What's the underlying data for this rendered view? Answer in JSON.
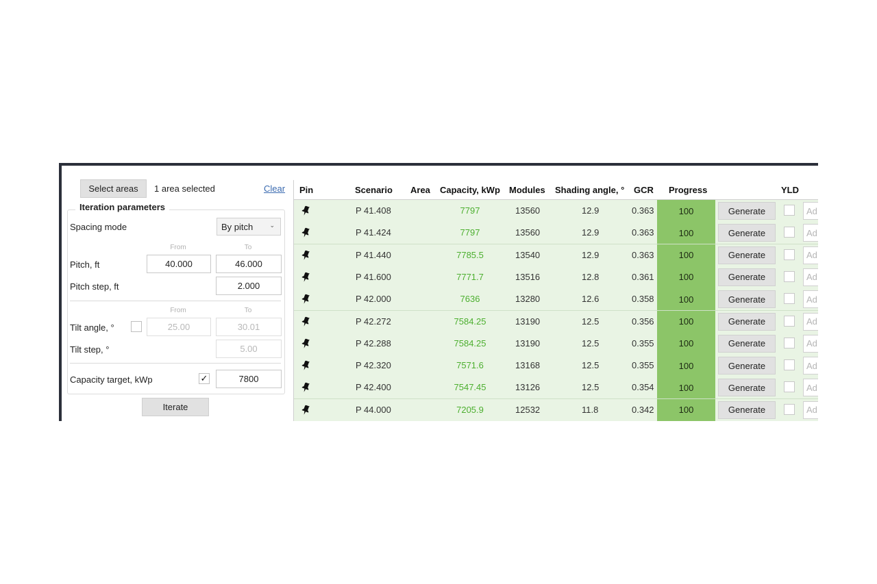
{
  "left_panel": {
    "select_areas_label": "Select areas",
    "area_status": "1 area selected",
    "clear_label": "Clear",
    "group_title": "Iteration parameters",
    "spacing_mode_label": "Spacing mode",
    "spacing_mode_value": "By pitch",
    "from_label": "From",
    "to_label": "To",
    "pitch_label": "Pitch, ft",
    "pitch_from": "40.000",
    "pitch_to": "46.000",
    "pitch_step_label": "Pitch step, ft",
    "pitch_step": "2.000",
    "tilt_angle_label": "Tilt angle, °",
    "tilt_from": "25.00",
    "tilt_to": "30.01",
    "tilt_step_label": "Tilt step, °",
    "tilt_step": "5.00",
    "capacity_target_label": "Capacity target, kWp",
    "capacity_target_checked": true,
    "capacity_target_check_glyph": "✓",
    "capacity_target": "7800",
    "iterate_label": "Iterate"
  },
  "grid": {
    "headers": {
      "pin": "Pin",
      "scenario": "Scenario",
      "area": "Area",
      "capacity": "Capacity, kWp",
      "modules": "Modules",
      "shading": "Shading angle, °",
      "gcr": "GCR",
      "progress": "Progress",
      "yld": "YLD"
    },
    "generate_label": "Generate",
    "yld_placeholder": "Ad",
    "rows": [
      {
        "scenario": "P 41.408",
        "capacity": "7797",
        "modules": "13560",
        "shading": "12.9",
        "gcr": "0.363",
        "progress": "100"
      },
      {
        "scenario": "P 41.424",
        "capacity": "7797",
        "modules": "13560",
        "shading": "12.9",
        "gcr": "0.363",
        "progress": "100"
      },
      {
        "scenario": "P 41.440",
        "capacity": "7785.5",
        "modules": "13540",
        "shading": "12.9",
        "gcr": "0.363",
        "progress": "100"
      },
      {
        "scenario": "P 41.600",
        "capacity": "7771.7",
        "modules": "13516",
        "shading": "12.8",
        "gcr": "0.361",
        "progress": "100"
      },
      {
        "scenario": "P 42.000",
        "capacity": "7636",
        "modules": "13280",
        "shading": "12.6",
        "gcr": "0.358",
        "progress": "100"
      },
      {
        "scenario": "P 42.272",
        "capacity": "7584.25",
        "modules": "13190",
        "shading": "12.5",
        "gcr": "0.356",
        "progress": "100"
      },
      {
        "scenario": "P 42.288",
        "capacity": "7584.25",
        "modules": "13190",
        "shading": "12.5",
        "gcr": "0.355",
        "progress": "100"
      },
      {
        "scenario": "P 42.320",
        "capacity": "7571.6",
        "modules": "13168",
        "shading": "12.5",
        "gcr": "0.355",
        "progress": "100"
      },
      {
        "scenario": "P 42.400",
        "capacity": "7547.45",
        "modules": "13126",
        "shading": "12.5",
        "gcr": "0.354",
        "progress": "100"
      },
      {
        "scenario": "P 44.000",
        "capacity": "7205.9",
        "modules": "12532",
        "shading": "11.8",
        "gcr": "0.342",
        "progress": "100"
      }
    ]
  },
  "colors": {
    "row_background": "#e9f4e4",
    "capacity_text": "#4caf2f",
    "progress_fill": "#8cc568",
    "link": "#3a6ab0"
  },
  "icons": {
    "pin": "pin-icon",
    "dropdown": "chevron-down-icon",
    "check": "checkmark-icon"
  }
}
